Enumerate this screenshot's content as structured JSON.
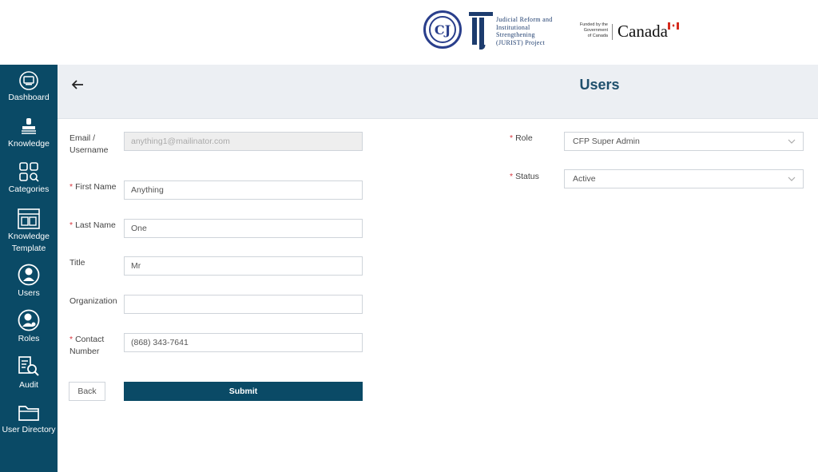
{
  "branding": {
    "jurist_text": "Judicial Reform and\nInstitutional\nStrengthening\n(JURIST) Project",
    "funded_text": "Funded by the\nGovernment\nof Canada",
    "canada_text": "Canada"
  },
  "sidebar": {
    "items": [
      {
        "label": "Dashboard",
        "icon": "monitor-icon"
      },
      {
        "label": "Knowledge",
        "icon": "stamp-icon"
      },
      {
        "label": "Categories",
        "icon": "categories-icon"
      },
      {
        "label": "Knowledge Template",
        "icon": "template-icon"
      },
      {
        "label": "Users",
        "icon": "user-circle-icon"
      },
      {
        "label": "Roles",
        "icon": "roles-icon"
      },
      {
        "label": "Audit",
        "icon": "audit-icon"
      },
      {
        "label": "User Directory",
        "icon": "folder-icon"
      }
    ]
  },
  "header": {
    "title": "Users"
  },
  "form": {
    "email": {
      "label": "Email / Username",
      "value": "anything1@mailinator.com"
    },
    "first_name": {
      "label": "First Name",
      "value": "Anything"
    },
    "last_name": {
      "label": "Last Name",
      "value": "One"
    },
    "title": {
      "label": "Title",
      "value": "Mr"
    },
    "organization": {
      "label": "Organization",
      "value": ""
    },
    "contact": {
      "label": "Contact Number",
      "value": "(868) 343-7641"
    },
    "role": {
      "label": "Role",
      "value": "CFP Super Admin"
    },
    "status": {
      "label": "Status",
      "value": "Active"
    },
    "required_mark": "*",
    "back_label": "Back",
    "submit_label": "Submit"
  },
  "colors": {
    "sidebar": "#0a4a66",
    "accent": "#1e4f6c",
    "required": "#d9363e"
  }
}
